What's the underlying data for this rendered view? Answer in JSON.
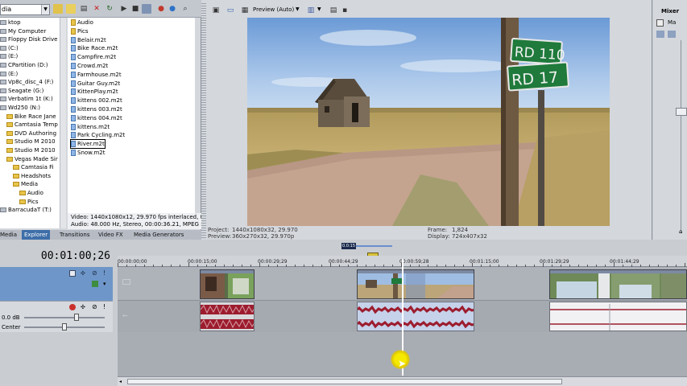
{
  "explorer": {
    "location_value": "dia",
    "tree": [
      {
        "label": "ktop",
        "type": "drive",
        "indent": 0
      },
      {
        "label": "My Computer",
        "type": "drive",
        "indent": 0
      },
      {
        "label": "Floppy Disk Drive (",
        "type": "drive",
        "indent": 0
      },
      {
        "label": "(C:)",
        "type": "drive",
        "indent": 0
      },
      {
        "label": "(E:)",
        "type": "drive",
        "indent": 0
      },
      {
        "label": "CPartition (D:)",
        "type": "drive",
        "indent": 0
      },
      {
        "label": "(E:)",
        "type": "drive",
        "indent": 0
      },
      {
        "label": "Vp8c_disc_4 (F:)",
        "type": "drive",
        "indent": 0
      },
      {
        "label": "Seagate (G:)",
        "type": "drive",
        "indent": 0
      },
      {
        "label": "Verbatim 1t (K:)",
        "type": "drive",
        "indent": 0
      },
      {
        "label": "Wd250 (N:)",
        "type": "drive",
        "indent": 0
      },
      {
        "label": "Bike Race Jane",
        "type": "folder",
        "indent": 1
      },
      {
        "label": "Camtasia Temp",
        "type": "folder",
        "indent": 1
      },
      {
        "label": "DVD Authoring",
        "type": "folder",
        "indent": 1
      },
      {
        "label": "Studio M 2010",
        "type": "folder",
        "indent": 1
      },
      {
        "label": "Studio M 2010",
        "type": "folder",
        "indent": 1
      },
      {
        "label": "Vegas Made Sir",
        "type": "folder",
        "indent": 1
      },
      {
        "label": "Camtasia Fi",
        "type": "folder",
        "indent": 2
      },
      {
        "label": "Headshots",
        "type": "folder",
        "indent": 2
      },
      {
        "label": "Media",
        "type": "folder",
        "indent": 2
      },
      {
        "label": "Audio",
        "type": "folder",
        "indent": 3
      },
      {
        "label": "Pics",
        "type": "folder",
        "indent": 3
      },
      {
        "label": "BarracudaT (T:)",
        "type": "drive",
        "indent": 0
      }
    ],
    "files": [
      {
        "name": "Audio",
        "type": "folder"
      },
      {
        "name": "Pics",
        "type": "folder"
      },
      {
        "name": "Belair.m2t",
        "type": "file"
      },
      {
        "name": "Bike Race.m2t",
        "type": "file"
      },
      {
        "name": "Campfire.m2t",
        "type": "file"
      },
      {
        "name": "Crowd.m2t",
        "type": "file"
      },
      {
        "name": "Farmhouse.m2t",
        "type": "file"
      },
      {
        "name": "Guitar Guy.m2t",
        "type": "file"
      },
      {
        "name": "KittenPlay.m2t",
        "type": "file"
      },
      {
        "name": "kittens 002.m2t",
        "type": "file"
      },
      {
        "name": "kittens 003.m2t",
        "type": "file"
      },
      {
        "name": "kittens 004.m2t",
        "type": "file"
      },
      {
        "name": "kittens.m2t",
        "type": "file"
      },
      {
        "name": "Park Cycling.m2t",
        "type": "file"
      },
      {
        "name": "River.m2t",
        "type": "file",
        "selected": true
      },
      {
        "name": "Snow.m2t",
        "type": "file"
      }
    ],
    "info_line1": "Video: 1440x1080x12, 29.970 fps interlaced, 00:00",
    "info_line2": "Audio: 48.000 Hz, Stereo, 00:00:36.21, MPEG Laye",
    "tabs": [
      "Media",
      "Explorer",
      "Transitions",
      "Video FX",
      "Media Generators"
    ],
    "active_tab": "Explorer"
  },
  "preview": {
    "mode_label": "Preview (Auto)",
    "project_label": "Project:",
    "project_value": "1440x1080x32, 29.970",
    "preview_label": "Preview:",
    "preview_value": "360x270x32, 29.970p",
    "frame_label": "Frame:",
    "frame_value": "1,824",
    "display_label": "Display:",
    "display_value": "724x407x32",
    "sign_line1": "RD 110",
    "sign_line2": "RD 17"
  },
  "mixer": {
    "title": "Mixer",
    "item": "Ma"
  },
  "timeline": {
    "timecode": "00:01:00;26",
    "ruler_labels": [
      "00:00:00;00",
      "00:00:15;00",
      "00:00:29;29",
      "00:00:44;29",
      "00:00:59;28",
      "00:01:15;00",
      "00:01:29;29",
      "00:01:44;29"
    ],
    "audio_volume": "0.0 dB",
    "audio_pan": "Center",
    "loop_label": "0.0:15"
  },
  "colors": {
    "panel_bg": "#d4d7dc",
    "accent_tab": "#3d6ea8",
    "audio_wave": "#9c1c2e",
    "cursor": "#f5e900"
  },
  "icons": [
    "folder-up-icon",
    "new-folder-icon",
    "delete-icon",
    "refresh-icon",
    "play-icon",
    "stop-icon",
    "views-icon",
    "favorites-icon",
    "preview-properties-icon",
    "save-snapshot-icon",
    "copy-snapshot-icon",
    "mute-icon",
    "solo-icon",
    "automation-icon",
    "track-fx-icon"
  ]
}
